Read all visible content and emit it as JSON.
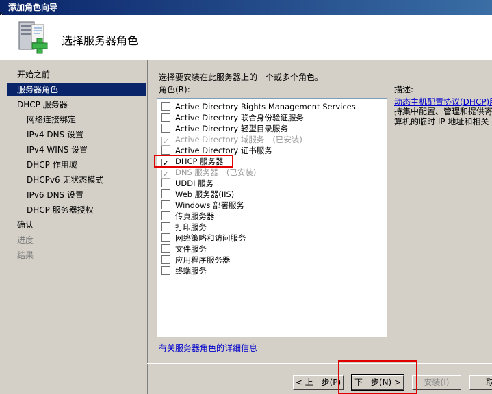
{
  "window": {
    "title": "添加角色向导"
  },
  "header": {
    "title": "选择服务器角色",
    "icon": "server-add-icon"
  },
  "nav": [
    {
      "label": "开始之前",
      "level": 0,
      "state": "normal"
    },
    {
      "label": "服务器角色",
      "level": 0,
      "state": "active"
    },
    {
      "label": "DHCP 服务器",
      "level": 0,
      "state": "normal"
    },
    {
      "label": "网络连接绑定",
      "level": 1,
      "state": "normal"
    },
    {
      "label": "IPv4 DNS 设置",
      "level": 1,
      "state": "normal"
    },
    {
      "label": "IPv4 WINS 设置",
      "level": 1,
      "state": "normal"
    },
    {
      "label": "DHCP 作用域",
      "level": 1,
      "state": "normal"
    },
    {
      "label": "DHCPv6 无状态模式",
      "level": 1,
      "state": "normal"
    },
    {
      "label": "IPv6 DNS 设置",
      "level": 1,
      "state": "normal"
    },
    {
      "label": "DHCP 服务器授权",
      "level": 1,
      "state": "normal"
    },
    {
      "label": "确认",
      "level": 0,
      "state": "normal"
    },
    {
      "label": "进度",
      "level": 0,
      "state": "disabled"
    },
    {
      "label": "结果",
      "level": 0,
      "state": "disabled"
    }
  ],
  "main": {
    "instruction": "选择要安装在此服务器上的一个或多个角色。",
    "roles_label": "角色(R):",
    "roles": [
      {
        "label": "Active Directory Rights Management Services",
        "checked": false,
        "disabled": false,
        "status": ""
      },
      {
        "label": "Active Directory 联合身份验证服务",
        "checked": false,
        "disabled": false,
        "status": ""
      },
      {
        "label": "Active Directory 轻型目录服务",
        "checked": false,
        "disabled": false,
        "status": ""
      },
      {
        "label": "Active Directory 域服务",
        "checked": true,
        "disabled": true,
        "status": "(已安装)"
      },
      {
        "label": "Active Directory 证书服务",
        "checked": false,
        "disabled": false,
        "status": ""
      },
      {
        "label": "DHCP 服务器",
        "checked": true,
        "disabled": false,
        "status": ""
      },
      {
        "label": "DNS 服务器",
        "checked": true,
        "disabled": true,
        "status": "(已安装)"
      },
      {
        "label": "UDDI 服务",
        "checked": false,
        "disabled": false,
        "status": ""
      },
      {
        "label": "Web 服务器(IIS)",
        "checked": false,
        "disabled": false,
        "status": ""
      },
      {
        "label": "Windows 部署服务",
        "checked": false,
        "disabled": false,
        "status": ""
      },
      {
        "label": "传真服务器",
        "checked": false,
        "disabled": false,
        "status": ""
      },
      {
        "label": "打印服务",
        "checked": false,
        "disabled": false,
        "status": ""
      },
      {
        "label": "网络策略和访问服务",
        "checked": false,
        "disabled": false,
        "status": ""
      },
      {
        "label": "文件服务",
        "checked": false,
        "disabled": false,
        "status": ""
      },
      {
        "label": "应用程序服务器",
        "checked": false,
        "disabled": false,
        "status": ""
      },
      {
        "label": "终端服务",
        "checked": false,
        "disabled": false,
        "status": ""
      }
    ],
    "more_info_link": "有关服务器角色的详细信息",
    "description_label": "描述:",
    "description_link": "动态主机配置协议(DHCP)服",
    "description_text": "持集中配置、管理和提供寄\n算机的临时 IP 地址和相关"
  },
  "buttons": {
    "back": "< 上一步(P)",
    "next": "下一步(N) >",
    "install": "安装(I)",
    "cancel": "取"
  },
  "colors": {
    "highlight": "#e00000",
    "title_bar": "#0a246a",
    "selected_nav": "#0a246a"
  }
}
